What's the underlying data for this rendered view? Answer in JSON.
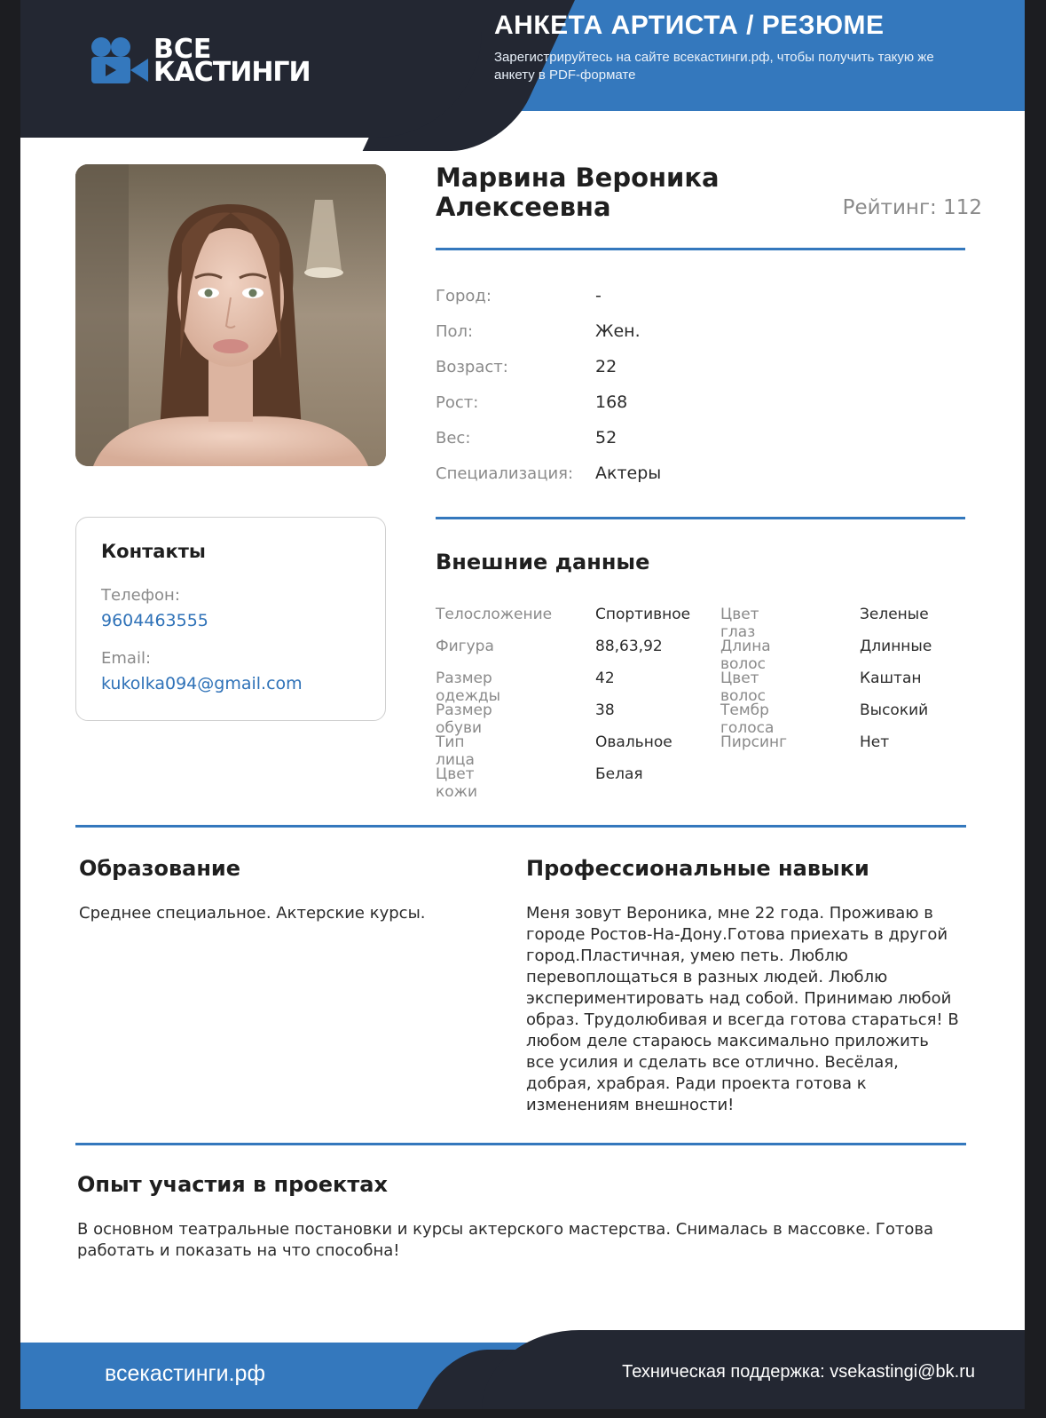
{
  "header": {
    "logo_line1": "ВСЕ",
    "logo_line2": "КАСТИНГИ",
    "title": "АНКЕТА АРТИСТА / РЕЗЮМЕ",
    "subtitle": "Зарегистрируйтесь на сайте всекастинги.рф, чтобы получить такую же анкету в PDF-формате"
  },
  "profile": {
    "name_line1": "Марвина Вероника",
    "name_line2": "Алексеевна",
    "rating": "Рейтинг: 112",
    "info": [
      {
        "label": "Город:",
        "value": "-"
      },
      {
        "label": "Пол:",
        "value": "Жен."
      },
      {
        "label": "Возраст:",
        "value": "22"
      },
      {
        "label": "Рост:",
        "value": "168"
      },
      {
        "label": "Вес:",
        "value": "52"
      },
      {
        "label": "Специализация:",
        "value": "Актеры"
      }
    ]
  },
  "contacts": {
    "title": "Контакты",
    "phone_label": "Телефон:",
    "phone": "9604463555",
    "email_label": "Email:",
    "email": "kukolka094@gmail.com"
  },
  "appearance": {
    "title": "Внешние данные",
    "rows": [
      {
        "k1": "Телосложение",
        "v1": "Спортивное",
        "k2": "Цвет глаз",
        "v2": "Зеленые"
      },
      {
        "k1": "Фигура",
        "v1": "88,63,92",
        "k2": "Длина волос",
        "v2": "Длинные"
      },
      {
        "k1": "Размер одежды",
        "v1": "42",
        "k2": "Цвет волос",
        "v2": "Каштан"
      },
      {
        "k1": "Размер обуви",
        "v1": "38",
        "k2": "Тембр голоса",
        "v2": "Высокий"
      },
      {
        "k1": "Тип лица",
        "v1": "Овальное",
        "k2": "Пирсинг",
        "v2": "Нет"
      },
      {
        "k1": "Цвет кожи",
        "v1": "Белая",
        "k2": "",
        "v2": ""
      }
    ]
  },
  "education": {
    "title": "Образование",
    "text": "Среднее специальное. Актерские курсы."
  },
  "skills": {
    "title": "Профессиональные навыки",
    "text": "Меня зовут Вероника, мне 22 года. Проживаю в городе Ростов-На-Дону.Готова приехать в другой город.Пластичная, умею петь. Люблю перевоплощаться в разных людей. Люблю экспериментировать над собой. Принимаю любой образ. Трудолюбивая и всегда готова стараться! В любом деле стараюсь максимально приложить все усилия и сделать все отлично. Весёлая, добрая, храбрая. Ради проекта готова к изменениям внешности!"
  },
  "experience": {
    "title": "Опыт участия в проектах",
    "text": "В основном театральные постановки и курсы актерского мастерства. Снималась в массовке. Готова работать и показать на что способна!"
  },
  "footer": {
    "site": "всекастинги.рф",
    "support": "Техническая поддержка: vsekastingi@bk.ru"
  },
  "colors": {
    "accent": "#3478bd",
    "dark": "#232732"
  }
}
